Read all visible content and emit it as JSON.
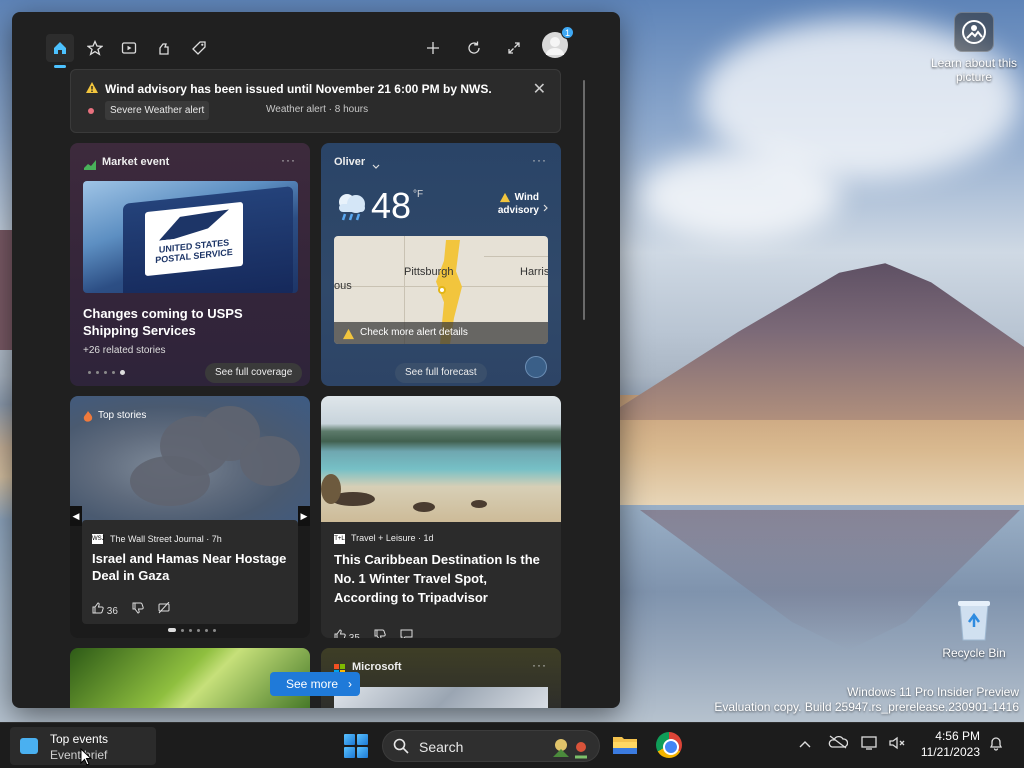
{
  "desktop": {
    "learn_label": "Learn about this picture",
    "recycle_label": "Recycle Bin",
    "watermark_line1": "Windows 11 Pro Insider Preview",
    "watermark_line2": "Evaluation copy. Build 25947.rs_prerelease.230901-1416"
  },
  "widgets": {
    "toolbar": {
      "icons": [
        "home-icon",
        "favorites-icon",
        "video-icon",
        "games-icon",
        "tag-icon",
        "add-icon",
        "refresh-icon",
        "expand-icon",
        "profile-avatar"
      ],
      "avatar_badge": "1"
    },
    "alert": {
      "title": "Wind advisory has been issued until November 21 6:00 PM by NWS.",
      "chip": "Severe Weather alert",
      "meta": "Weather alert · 8 hours",
      "close_glyph": "✕"
    },
    "market": {
      "label": "Market event",
      "more": "···",
      "image_caption": "UNITED STATES POSTAL SERVICE",
      "headline": "Changes coming to USPS Shipping Services",
      "related": "+26 related stories",
      "cta": "See full coverage"
    },
    "weather": {
      "location": "Oliver",
      "more": "···",
      "temperature": "48",
      "unit": "°F",
      "advisory": "Wind advisory",
      "map_cities": [
        "Pittsburgh",
        "Harris",
        "ous"
      ],
      "map_footer": "Check more alert details",
      "cta": "See full forecast"
    },
    "top_story": {
      "label": "Top stories",
      "source": "The Wall Street Journal · 7h",
      "headline": "Israel and Hamas Near Hostage Deal in Gaza",
      "likes": "36"
    },
    "travel": {
      "source": "Travel + Leisure · 1d",
      "headline": "This Caribbean Destination Is the No. 1 Winter Travel Spot, According to Tripadvisor",
      "likes": "35"
    },
    "microsoft": {
      "label": "Microsoft",
      "more": "···"
    },
    "see_more": "See more"
  },
  "taskbar": {
    "widget_title": "Top events",
    "widget_subtitle": "Event brief",
    "search_label": "Search",
    "time": "4:56 PM",
    "date": "11/21/2023"
  },
  "colors": {
    "accent": "#1f7ad9",
    "panel_bg": "#202020",
    "alert_dot": "#e8717e"
  }
}
